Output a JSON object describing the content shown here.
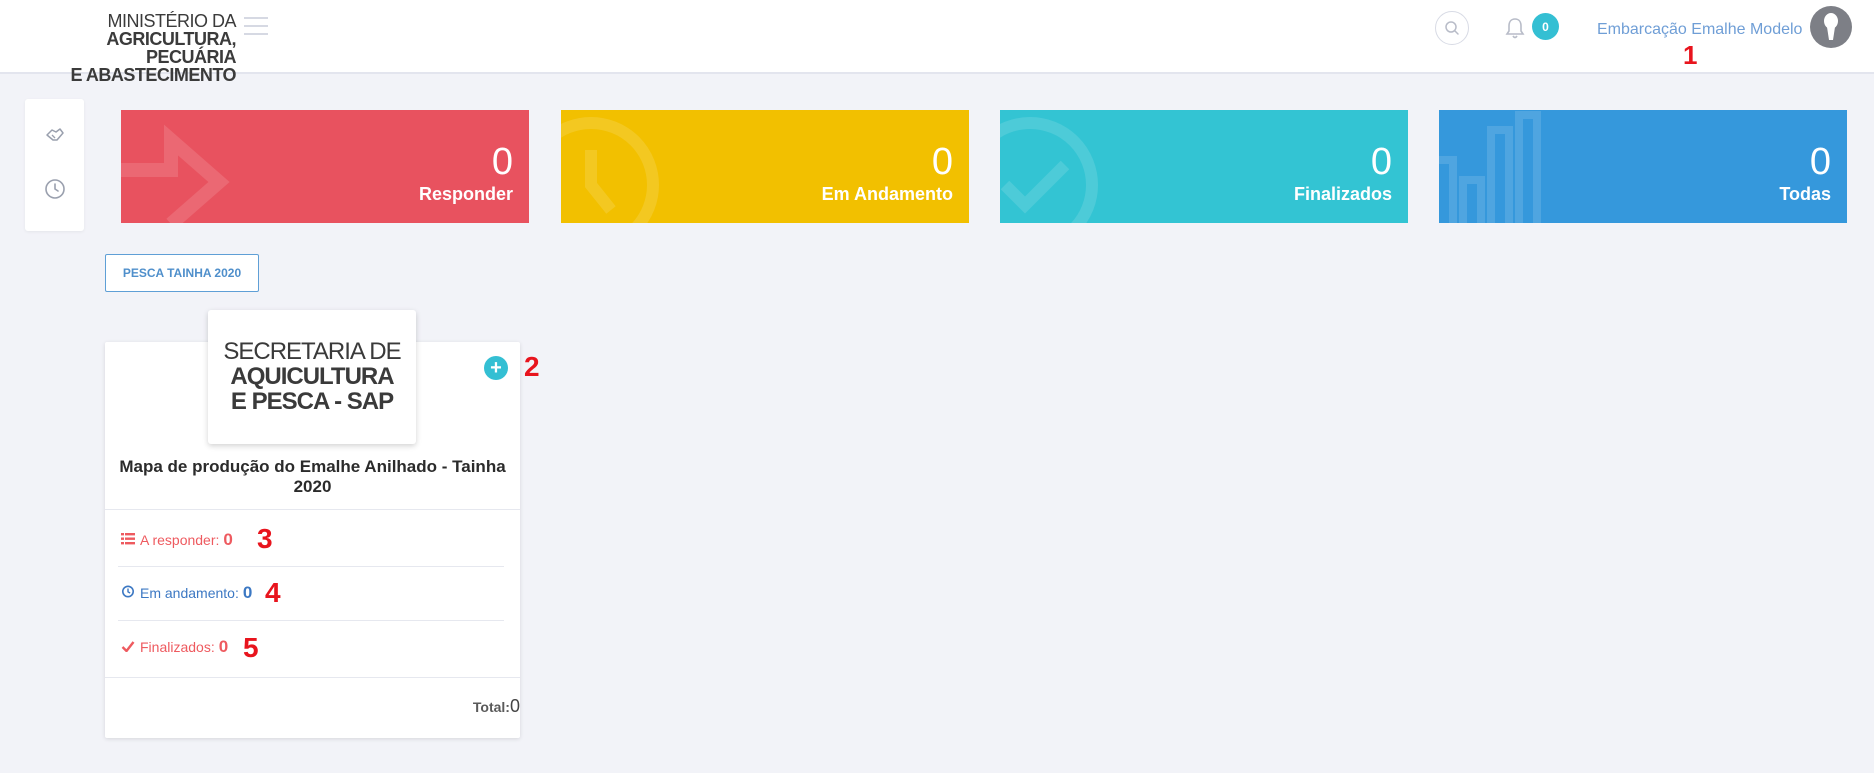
{
  "header": {
    "logo_line1": "MINISTÉRIO DA",
    "logo_line2": "AGRICULTURA, PECUÁRIA",
    "logo_line3": "E ABASTECIMENTO",
    "notification_count": "0",
    "user_name": "Embarcação Emalhe Modelo"
  },
  "annotations": [
    "1",
    "2",
    "3",
    "4",
    "5"
  ],
  "tiles": [
    {
      "value": "0",
      "label": "Responder",
      "color": "#e8525f",
      "icon": "arrow-right-icon"
    },
    {
      "value": "0",
      "label": "Em Andamento",
      "color": "#f2c000",
      "icon": "clock-icon"
    },
    {
      "value": "0",
      "label": "Finalizados",
      "color": "#33c4d3",
      "icon": "check-circle-icon"
    },
    {
      "value": "0",
      "label": "Todas",
      "color": "#3598dc",
      "icon": "bar-chart-icon"
    }
  ],
  "filter_chip": "PESCA TAINHA 2020",
  "card": {
    "logo_line1": "SECRETARIA DE",
    "logo_line2": "AQUICULTURA",
    "logo_line3": "E PESCA - SAP",
    "title": "Mapa de produção do Emalhe Anilhado - Tainha 2020",
    "a_responder_label": "A responder:",
    "a_responder_value": "0",
    "em_andamento_label": "Em andamento:",
    "em_andamento_value": "0",
    "finalizados_label": "Finalizados:",
    "finalizados_value": "0",
    "total_label": "Total:",
    "total_value": "0"
  }
}
